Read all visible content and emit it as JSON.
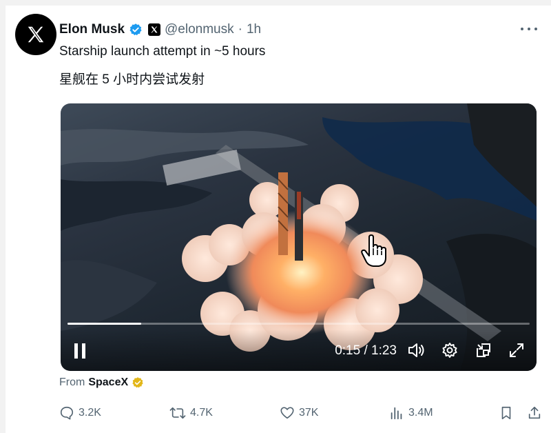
{
  "post": {
    "author_name": "Elon Musk",
    "handle": "@elonmusk",
    "separator": "·",
    "time": "1h",
    "text_line_1": "Starship launch attempt in ~5 hours",
    "text_line_2": "星舰在 5 小时内尝试发射",
    "verified_color": "#1d9bf0"
  },
  "video": {
    "current_time": "0:15",
    "duration": "1:23",
    "time_separator": " / ",
    "progress": 0.16,
    "icons": [
      "pause-icon",
      "volume-icon",
      "settings-icon",
      "pip-icon",
      "fullscreen-icon",
      "hand-cursor-icon"
    ]
  },
  "source": {
    "prefix": "From",
    "name": "SpaceX",
    "badge_color": "#e2b719"
  },
  "actions": {
    "replies": "3.2K",
    "reposts": "4.7K",
    "likes": "37K",
    "views": "3.4M",
    "icons": [
      "reply-icon",
      "repost-icon",
      "like-icon",
      "views-icon",
      "bookmark-icon",
      "share-icon"
    ]
  }
}
